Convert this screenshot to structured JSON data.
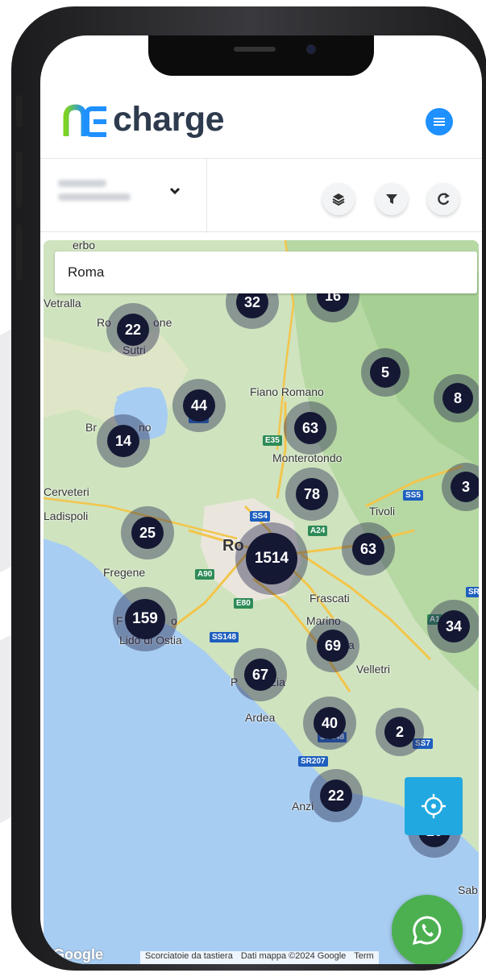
{
  "app": {
    "logo_text": "charge",
    "brand_color": "#2e3b4e",
    "accent_color": "#1e90ff",
    "logo_gradient": [
      "#7ed321",
      "#1e90ff"
    ]
  },
  "toolbar": {
    "chevron_icon": "chevron-down-icon",
    "layers_icon": "layers-icon",
    "filter_icon": "filter-icon",
    "refresh_icon": "refresh-icon"
  },
  "search": {
    "value": "Roma"
  },
  "map": {
    "places": [
      {
        "name": "Vetralla",
        "id": "vetralla"
      },
      {
        "name": "Ro",
        "id": "ronciglione-a"
      },
      {
        "name": "one",
        "id": "ronciglione-b"
      },
      {
        "name": "Sutri",
        "id": "sutri"
      },
      {
        "name": "Fiano Romano",
        "id": "fiano"
      },
      {
        "name": "Monterotondo",
        "id": "monterotondo"
      },
      {
        "name": "Br",
        "id": "bracciano-a"
      },
      {
        "name": "no",
        "id": "bracciano-b"
      },
      {
        "name": "Cerveteri",
        "id": "cerveteri"
      },
      {
        "name": "Ladispoli",
        "id": "ladispoli"
      },
      {
        "name": "Tivoli",
        "id": "tivoli"
      },
      {
        "name": "Ro",
        "id": "roma"
      },
      {
        "name": "Fregene",
        "id": "fregene"
      },
      {
        "name": "Frascati",
        "id": "frascati"
      },
      {
        "name": "Marino",
        "id": "marino"
      },
      {
        "name": "Lido di Ostia",
        "id": "ostia"
      },
      {
        "name": "Velletri",
        "id": "velletri"
      },
      {
        "name": "P",
        "id": "pomezia-a"
      },
      {
        "name": "zia",
        "id": "pomezia-b"
      },
      {
        "name": "Ardea",
        "id": "ardea"
      },
      {
        "name": "Anzi",
        "id": "anzio"
      },
      {
        "name": "Sab",
        "id": "sabaudia"
      },
      {
        "name": "F",
        "id": "fiumicino"
      },
      {
        "name": "o",
        "id": "fiumicino-b"
      },
      {
        "name": "A",
        "id": "aprilia"
      },
      {
        "name": "a",
        "id": "albano"
      },
      {
        "name": "erbo",
        "id": "viterbo"
      }
    ],
    "roads": [
      {
        "name": "E35",
        "id": "e35"
      },
      {
        "name": "SS4",
        "id": "ss4"
      },
      {
        "name": "A24",
        "id": "a24"
      },
      {
        "name": "SS5",
        "id": "ss5"
      },
      {
        "name": "A90",
        "id": "a90"
      },
      {
        "name": "E80",
        "id": "e80"
      },
      {
        "name": "SS148",
        "id": "ss148"
      },
      {
        "name": "SS148",
        "id": "ss148b"
      },
      {
        "name": "SR207",
        "id": "sr207"
      },
      {
        "name": "SS7",
        "id": "ss7"
      },
      {
        "name": "SR",
        "id": "sr"
      },
      {
        "name": "SS2",
        "id": "ss2"
      },
      {
        "name": "A1",
        "id": "a1"
      }
    ],
    "clusters": [
      {
        "count": "32",
        "id": "c32"
      },
      {
        "count": "16",
        "id": "c16"
      },
      {
        "count": "22",
        "id": "c22a"
      },
      {
        "count": "5",
        "id": "c5"
      },
      {
        "count": "8",
        "id": "c8"
      },
      {
        "count": "44",
        "id": "c44"
      },
      {
        "count": "63",
        "id": "c63a"
      },
      {
        "count": "14",
        "id": "c14"
      },
      {
        "count": "78",
        "id": "c78"
      },
      {
        "count": "3",
        "id": "c3"
      },
      {
        "count": "25",
        "id": "c25"
      },
      {
        "count": "1514",
        "id": "c1514"
      },
      {
        "count": "63",
        "id": "c63b"
      },
      {
        "count": "159",
        "id": "c159"
      },
      {
        "count": "34",
        "id": "c34"
      },
      {
        "count": "69",
        "id": "c69"
      },
      {
        "count": "67",
        "id": "c67"
      },
      {
        "count": "40",
        "id": "c40"
      },
      {
        "count": "2",
        "id": "c2"
      },
      {
        "count": "22",
        "id": "c22b"
      },
      {
        "count": "20",
        "id": "c20"
      }
    ],
    "attribution": {
      "google": "Google",
      "shortcuts": "Scorciatoie da tastiera",
      "data": "Dati mappa ©2024 Google",
      "terms": "Term"
    },
    "locate_icon": "crosshair-icon",
    "whatsapp_icon": "whatsapp-icon"
  }
}
